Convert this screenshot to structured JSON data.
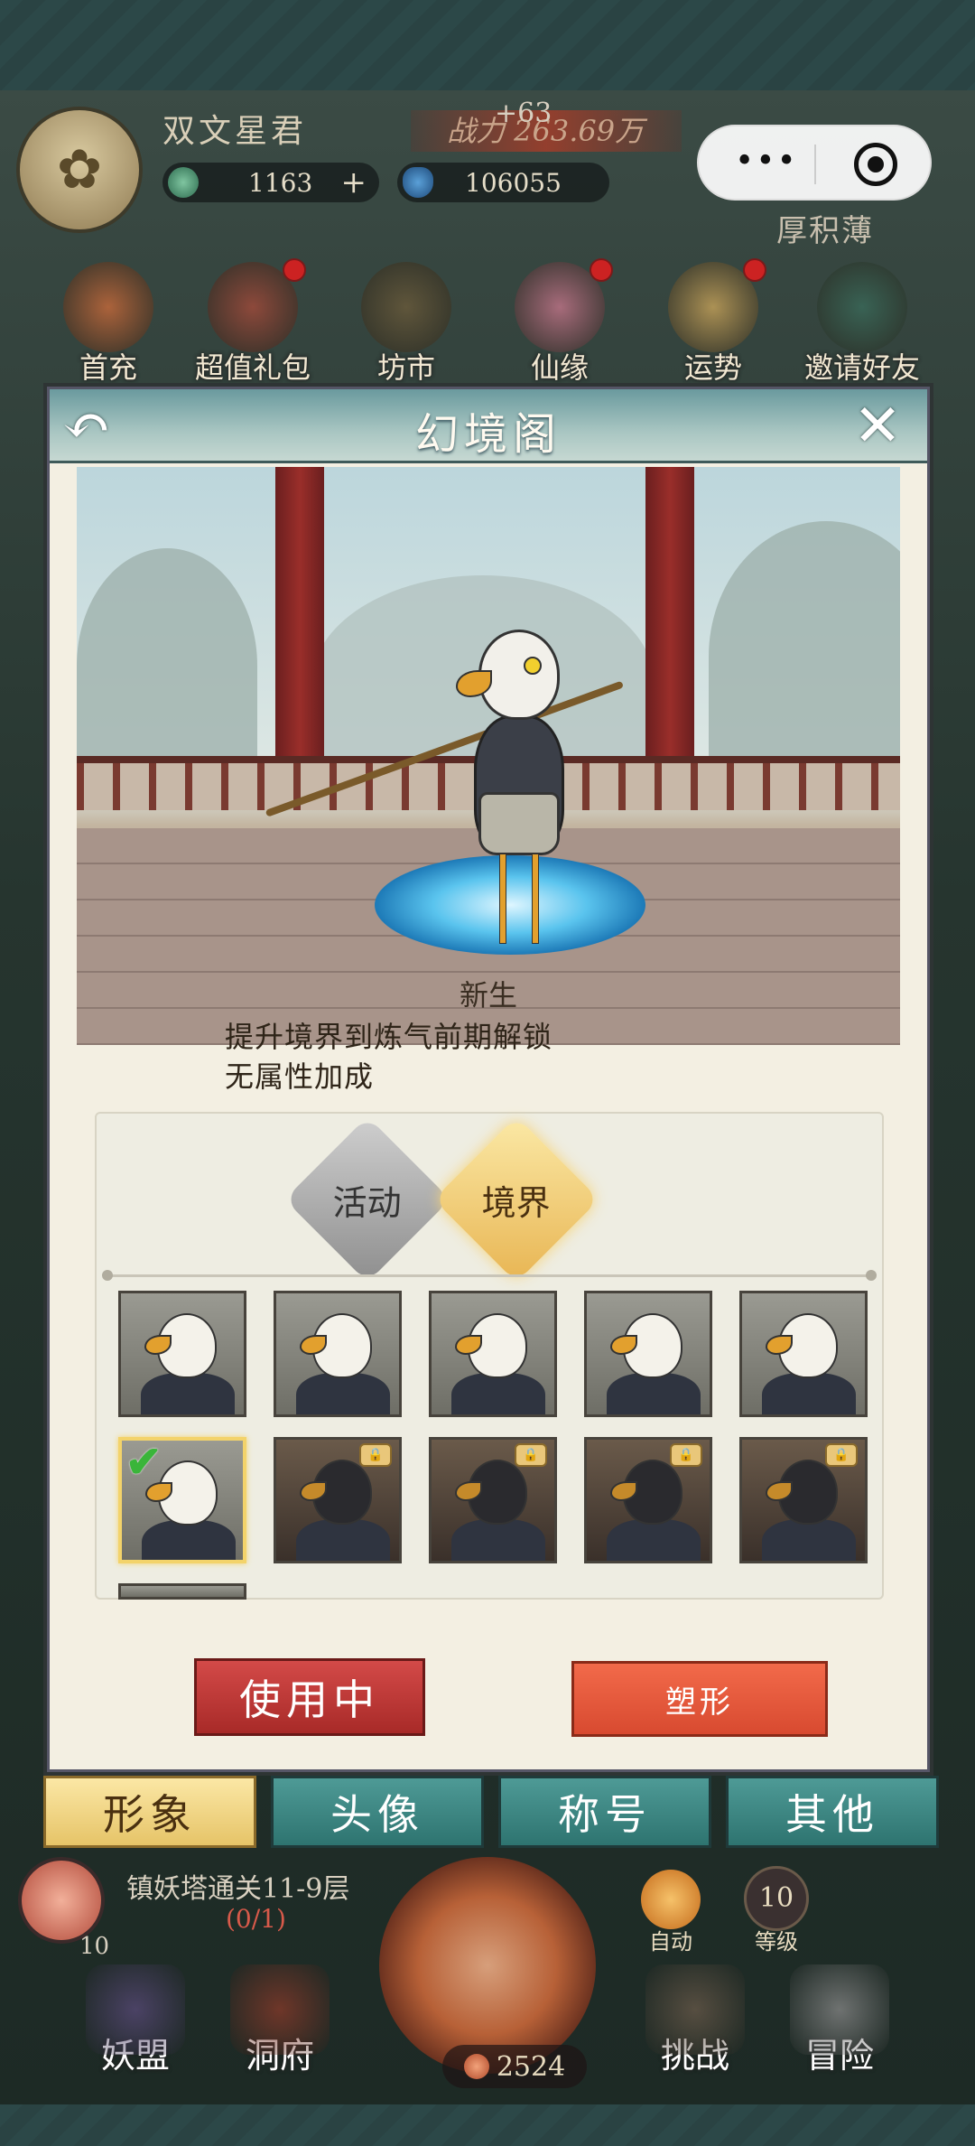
{
  "header": {
    "player_name": "双文星君",
    "power_label": "战力 263.69万",
    "power_delta": "+63",
    "jade": "1163",
    "jade_plus": "+",
    "gems": "106055",
    "accumulate": "厚积薄",
    "capsule_menu": "•••"
  },
  "top_icons": [
    {
      "label": "首充",
      "color": "#c96a3a",
      "badge": false
    },
    {
      "label": "超值礼包",
      "color": "#a34a3a",
      "badge": true
    },
    {
      "label": "坊市",
      "color": "#6a5a3a",
      "badge": false
    },
    {
      "label": "仙缘",
      "color": "#c4758a",
      "badge": true
    },
    {
      "label": "运势",
      "color": "#c9a45a",
      "badge": true
    },
    {
      "label": "邀请好友",
      "color": "#3a6a5a",
      "badge": false
    }
  ],
  "modal": {
    "title": "幻境阁",
    "back_icon": "↶",
    "close_icon": "✕",
    "skin_name": "新生",
    "unlock_text": "提升境界到炼气前期解锁",
    "bonus_text": "无属性加成"
  },
  "categories": {
    "activity": "活动",
    "realm": "境界",
    "active": "realm"
  },
  "skins": [
    {
      "row": 0,
      "col": 0,
      "locked": false,
      "dark": false,
      "selected": false
    },
    {
      "row": 0,
      "col": 1,
      "locked": false,
      "dark": false,
      "selected": false
    },
    {
      "row": 0,
      "col": 2,
      "locked": false,
      "dark": false,
      "selected": false
    },
    {
      "row": 0,
      "col": 3,
      "locked": false,
      "dark": false,
      "selected": false
    },
    {
      "row": 0,
      "col": 4,
      "locked": false,
      "dark": false,
      "selected": false
    },
    {
      "row": 1,
      "col": 0,
      "locked": false,
      "dark": false,
      "selected": true
    },
    {
      "row": 1,
      "col": 1,
      "locked": true,
      "dark": true,
      "selected": false
    },
    {
      "row": 1,
      "col": 2,
      "locked": true,
      "dark": true,
      "selected": false
    },
    {
      "row": 1,
      "col": 3,
      "locked": true,
      "dark": true,
      "selected": false
    },
    {
      "row": 1,
      "col": 4,
      "locked": true,
      "dark": true,
      "selected": false
    }
  ],
  "buttons": {
    "in_use": "使用中",
    "shape": "塑形"
  },
  "bottom_tabs": [
    {
      "label": "形象",
      "active": true
    },
    {
      "label": "头像",
      "active": false
    },
    {
      "label": "称号",
      "active": false
    },
    {
      "label": "其他",
      "active": false
    }
  ],
  "hud": {
    "quest_text": "镇妖塔通关11-9层",
    "quest_progress": "(0/1)",
    "quest_level": "10",
    "auto_label": "自动",
    "level_num": "10",
    "level_label": "等级",
    "coins": "2524"
  },
  "bottom_nav": [
    {
      "label": "妖盟"
    },
    {
      "label": "洞府"
    },
    {
      "label": "挑战"
    },
    {
      "label": "冒险"
    }
  ]
}
